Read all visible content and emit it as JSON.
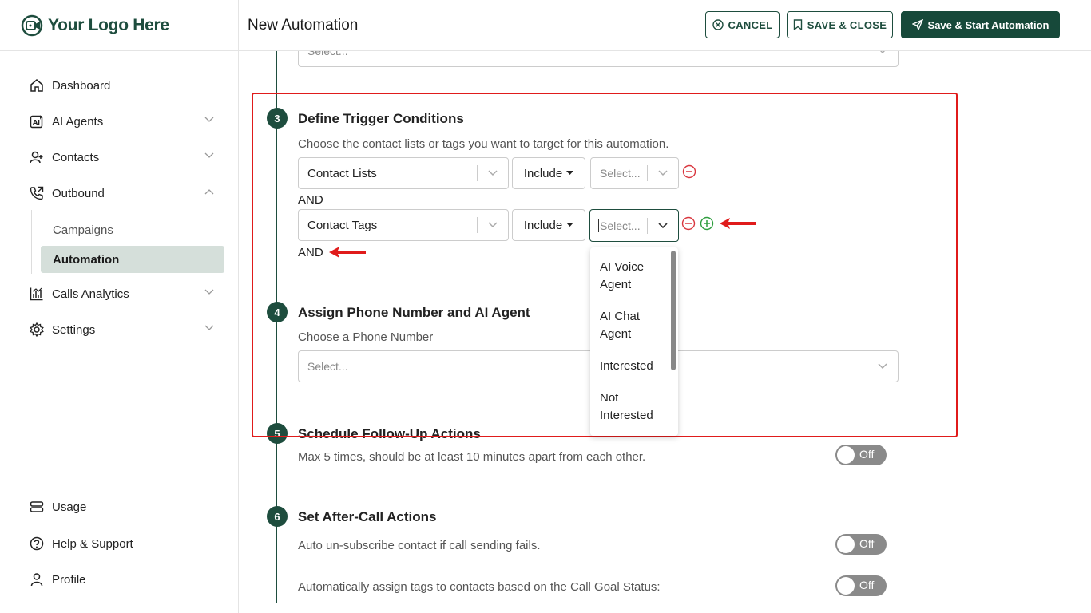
{
  "sidebar": {
    "logo_text": "Your Logo Here",
    "items": [
      {
        "label": "Dashboard"
      },
      {
        "label": "AI Agents"
      },
      {
        "label": "Contacts"
      },
      {
        "label": "Outbound"
      },
      {
        "label": "Calls Analytics"
      },
      {
        "label": "Settings"
      }
    ],
    "sub_items": [
      {
        "label": "Campaigns"
      },
      {
        "label": "Automation"
      }
    ],
    "bottom_items": [
      {
        "label": "Usage"
      },
      {
        "label": "Help & Support"
      },
      {
        "label": "Profile"
      }
    ]
  },
  "header": {
    "title": "New Automation",
    "cancel_label": "CANCEL",
    "save_close_label": "SAVE & CLOSE",
    "save_start_label": "Save & Start Automation"
  },
  "main": {
    "top_select_placeholder": "Select...",
    "step3": {
      "number": "3",
      "title": "Define Trigger Conditions",
      "description": "Choose the contact lists or tags you want to target for this automation.",
      "row1": {
        "type": "Contact Lists",
        "mode": "Include",
        "value_placeholder": "Select..."
      },
      "and1": "AND",
      "row2": {
        "type": "Contact Tags",
        "mode": "Include",
        "value_placeholder": "Select..."
      },
      "and2": "AND"
    },
    "dropdown_options": [
      "AI Voice Agent",
      "AI Chat Agent",
      "Interested",
      "Not Interested"
    ],
    "step4": {
      "number": "4",
      "title": "Assign Phone Number and AI Agent",
      "description": "Choose a Phone Number",
      "placeholder": "Select..."
    },
    "step5": {
      "number": "5",
      "title": "Schedule Follow-Up Actions",
      "description": "Max 5 times, should be at least 10 minutes apart from each other.",
      "toggle": "Off"
    },
    "step6": {
      "number": "6",
      "title": "Set After-Call Actions",
      "option1": "Auto un-subscribe contact if call sending fails.",
      "option1_toggle": "Off",
      "option2": "Automatically assign tags to contacts based on the Call Goal Status:",
      "option2_toggle": "Off"
    }
  },
  "colors": {
    "brand": "#1e4d3e",
    "highlight": "#e01b1b",
    "remove": "#d9363e",
    "add": "#2e9e3e"
  }
}
